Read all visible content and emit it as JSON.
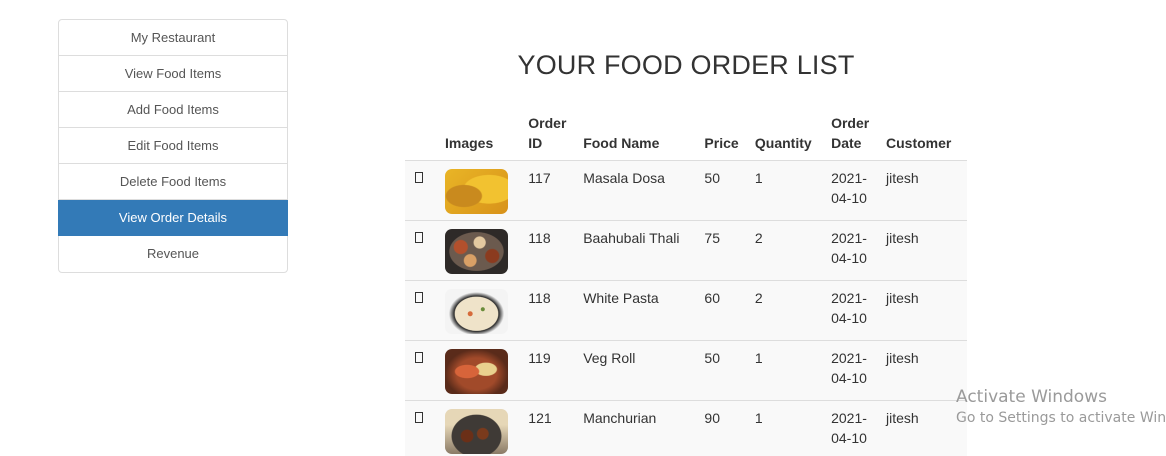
{
  "sidebar": {
    "items": [
      {
        "label": "My Restaurant"
      },
      {
        "label": "View Food Items"
      },
      {
        "label": "Add Food Items"
      },
      {
        "label": "Edit Food Items"
      },
      {
        "label": "Delete Food Items"
      },
      {
        "label": "View Order Details",
        "active": true
      },
      {
        "label": "Revenue"
      }
    ]
  },
  "main": {
    "title": "YOUR FOOD ORDER LIST",
    "table": {
      "headers": {
        "checkbox": "",
        "images": "Images",
        "order_id_1": "Order",
        "order_id_2": "ID",
        "food_name": "Food Name",
        "price": "Price",
        "quantity": "Quantity",
        "order_date_1": "Order",
        "order_date_2": "Date",
        "customer": "Customer"
      },
      "rows": [
        {
          "image": "masala-dosa-image",
          "order_id": "117",
          "food_name": "Masala Dosa",
          "price": "50",
          "quantity": "1",
          "date_1": "2021-",
          "date_2": "04-10",
          "customer": "jitesh"
        },
        {
          "image": "baahubali-thali-image",
          "order_id": "118",
          "food_name": "Baahubali Thali",
          "price": "75",
          "quantity": "2",
          "date_1": "2021-",
          "date_2": "04-10",
          "customer": "jitesh"
        },
        {
          "image": "white-pasta-image",
          "order_id": "118",
          "food_name": "White Pasta",
          "price": "60",
          "quantity": "2",
          "date_1": "2021-",
          "date_2": "04-10",
          "customer": "jitesh"
        },
        {
          "image": "veg-roll-image",
          "order_id": "119",
          "food_name": "Veg Roll",
          "price": "50",
          "quantity": "1",
          "date_1": "2021-",
          "date_2": "04-10",
          "customer": "jitesh"
        },
        {
          "image": "manchurian-image",
          "order_id": "121",
          "food_name": "Manchurian",
          "price": "90",
          "quantity": "1",
          "date_1": "2021-",
          "date_2": "04-10",
          "customer": "jitesh"
        }
      ]
    }
  },
  "watermark": {
    "title": "Activate Windows",
    "subtitle": "Go to Settings to activate Windows."
  },
  "colors": {
    "active_item_bg": "#337ab7",
    "active_item_text": "#ffffff",
    "row_bg": "#f9f9f9",
    "border": "#dddddd"
  }
}
